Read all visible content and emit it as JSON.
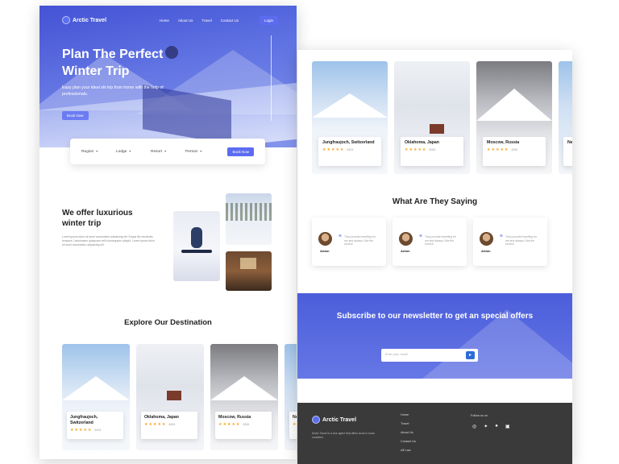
{
  "nav": {
    "logo": "Arctic Travel",
    "links": [
      "Home",
      "About Us",
      "Travel",
      "Contact Us"
    ],
    "login": "Login"
  },
  "hero": {
    "title": "Plan The Perfect Winter Trip",
    "subtitle": "Easy plan your ideal ski trip from home with the help of professionals.",
    "button": "Book Now"
  },
  "search": {
    "fields": [
      "Region",
      "Lodge",
      "Resort",
      "Person"
    ],
    "button": "Book Now"
  },
  "offer": {
    "title": "We offer luxurious winter trip",
    "text": "Lorem ipsum dolor sit amet consectetur adipiscing elit. Eaque illo reiciendis tempora. Laboriosam quisquam velit consequatur aliquid. Lorem ipsum dolor sit amet consectetur adipiscing elit."
  },
  "explore": {
    "title": "Explore Our Destination",
    "cards": [
      {
        "name": "Jungfraujoch, Switzerland",
        "stars": "★★★★★",
        "reviews": "5403"
      },
      {
        "name": "Oklahoma, Japan",
        "stars": "★★★★★",
        "reviews": "5063"
      },
      {
        "name": "Moscow, Russia",
        "stars": "★★★★★",
        "reviews": "2826"
      },
      {
        "name": "Ne",
        "stars": "★★",
        "reviews": ""
      }
    ]
  },
  "testimonials": {
    "title": "What  Are They Saying",
    "items": [
      {
        "name": "Anton",
        "text": "They provide travelling for me and always I like the service."
      },
      {
        "name": "Anton",
        "text": "They provide travelling for me and always I like the service."
      },
      {
        "name": "Anton",
        "text": "They provide travelling for me and always I like the service."
      }
    ]
  },
  "newsletter": {
    "title": "Subscribe to our newsletter to get an special offers",
    "placeholder": "Enter your email"
  },
  "footer": {
    "logo": "Arctic Travel",
    "description": "Arctic Travel is a tour agent that offers tours in snow countries.",
    "links": [
      "Home",
      "Travel",
      "About Us",
      "Contact Us",
      "Aff Law"
    ],
    "follow": "Follow us on",
    "social_icons": [
      "instagram-icon",
      "twitter-icon",
      "facebook-icon",
      "linkedin-icon"
    ]
  },
  "colors": {
    "accent": "#5c6cf0",
    "hero": "#3a4cd8",
    "footer": "#3a3a3a",
    "star": "#f5a623"
  }
}
